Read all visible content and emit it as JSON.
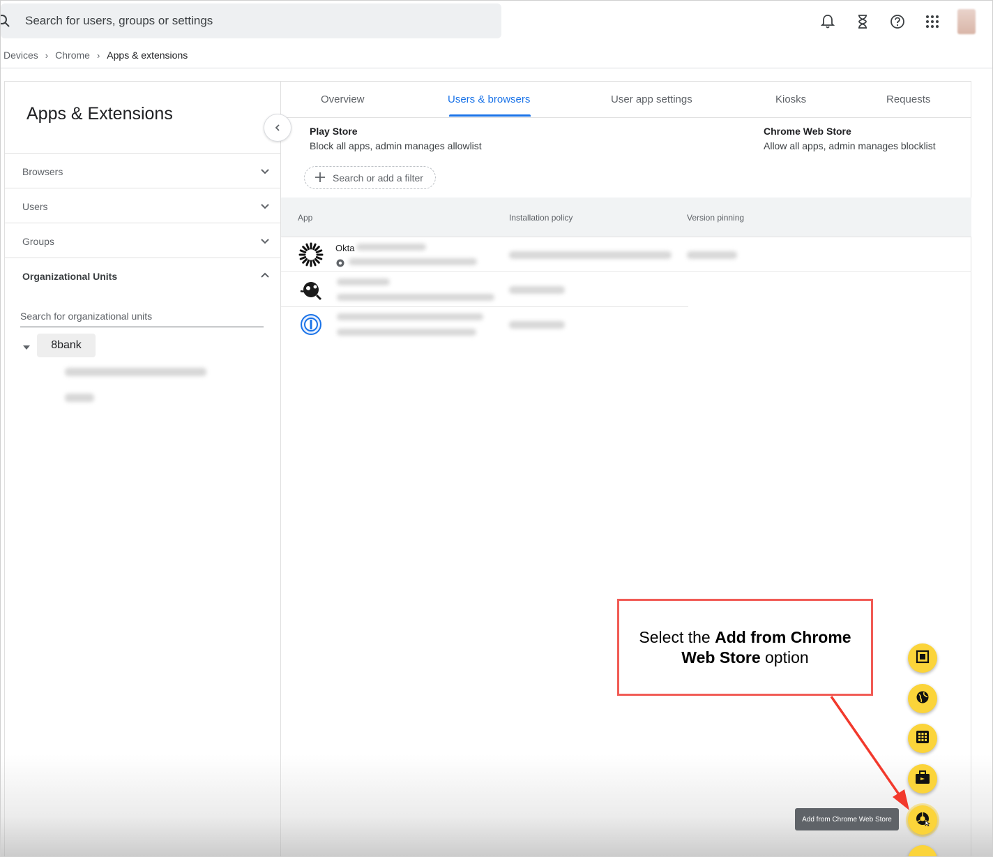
{
  "header": {
    "search_placeholder": "Search for users, groups or settings",
    "icons": [
      "bell-icon",
      "hourglass-icon",
      "help-icon",
      "apps-grid-icon"
    ]
  },
  "breadcrumb": {
    "items": [
      "Devices",
      "Chrome",
      "Apps & extensions"
    ]
  },
  "left_panel": {
    "title": "Apps & Extensions",
    "sections": [
      {
        "label": "Browsers",
        "expanded": false
      },
      {
        "label": "Users",
        "expanded": false
      },
      {
        "label": "Groups",
        "expanded": false
      },
      {
        "label": "Organizational Units",
        "expanded": true
      }
    ],
    "ou_search_placeholder": "Search for organizational units",
    "org_root": "8bank"
  },
  "tabs": [
    {
      "label": "Overview",
      "active": false
    },
    {
      "label": "Users & browsers",
      "active": true
    },
    {
      "label": "User app settings",
      "active": false
    },
    {
      "label": "Kiosks",
      "active": false
    },
    {
      "label": "Requests",
      "active": false
    }
  ],
  "stores": {
    "play": {
      "title": "Play Store",
      "desc": "Block all apps, admin manages allowlist"
    },
    "chrome": {
      "title": "Chrome Web Store",
      "desc": "Allow all apps, admin manages blocklist"
    }
  },
  "filter": {
    "label": "Search or add a filter"
  },
  "table": {
    "columns": [
      "App",
      "Installation policy",
      "Version pinning"
    ],
    "rows": [
      {
        "name": "Okta",
        "icon": "okta-sunburst-icon"
      },
      {
        "name": "",
        "icon": "extension-icon"
      },
      {
        "name": "",
        "icon": "password-manager-icon"
      }
    ]
  },
  "fab": {
    "tooltip": "Add from Chrome Web Store",
    "buttons": [
      "android-app-icon",
      "web-app-icon",
      "grid-app-icon",
      "private-app-icon",
      "chrome-web-store-icon"
    ]
  },
  "callout": {
    "prefix": "Select the ",
    "bold": "Add from Chrome Web Store",
    "suffix": " option",
    "border_color": "#f15b55"
  },
  "colors": {
    "accent": "#1a73e8",
    "fab": "#fbd43a"
  }
}
